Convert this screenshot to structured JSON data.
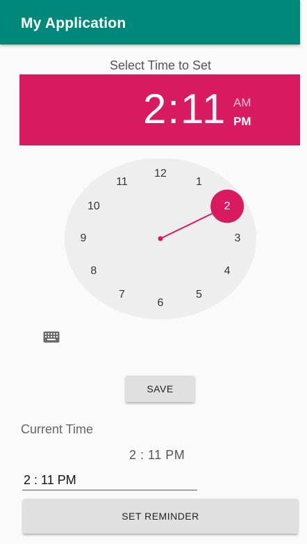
{
  "app": {
    "title": "My Application"
  },
  "picker": {
    "prompt": "Select Time to Set",
    "hour": "2",
    "separator": ":",
    "minute": "11",
    "am_label": "AM",
    "pm_label": "PM",
    "selected_period": "PM",
    "dial_numbers": [
      "12",
      "1",
      "2",
      "3",
      "4",
      "5",
      "6",
      "7",
      "8",
      "9",
      "10",
      "11"
    ],
    "selected_hour": 2
  },
  "icons": {
    "keyboard": "keyboard-icon"
  },
  "buttons": {
    "save": "SAVE",
    "set_reminder": "SET REMINDER"
  },
  "current": {
    "label": "Current Time",
    "value": "2 : 11 PM"
  },
  "input": {
    "value": "2 : 11 PM"
  },
  "colors": {
    "appbar": "#00897b",
    "accent": "#d81b60",
    "dial": "#eeeeee"
  }
}
